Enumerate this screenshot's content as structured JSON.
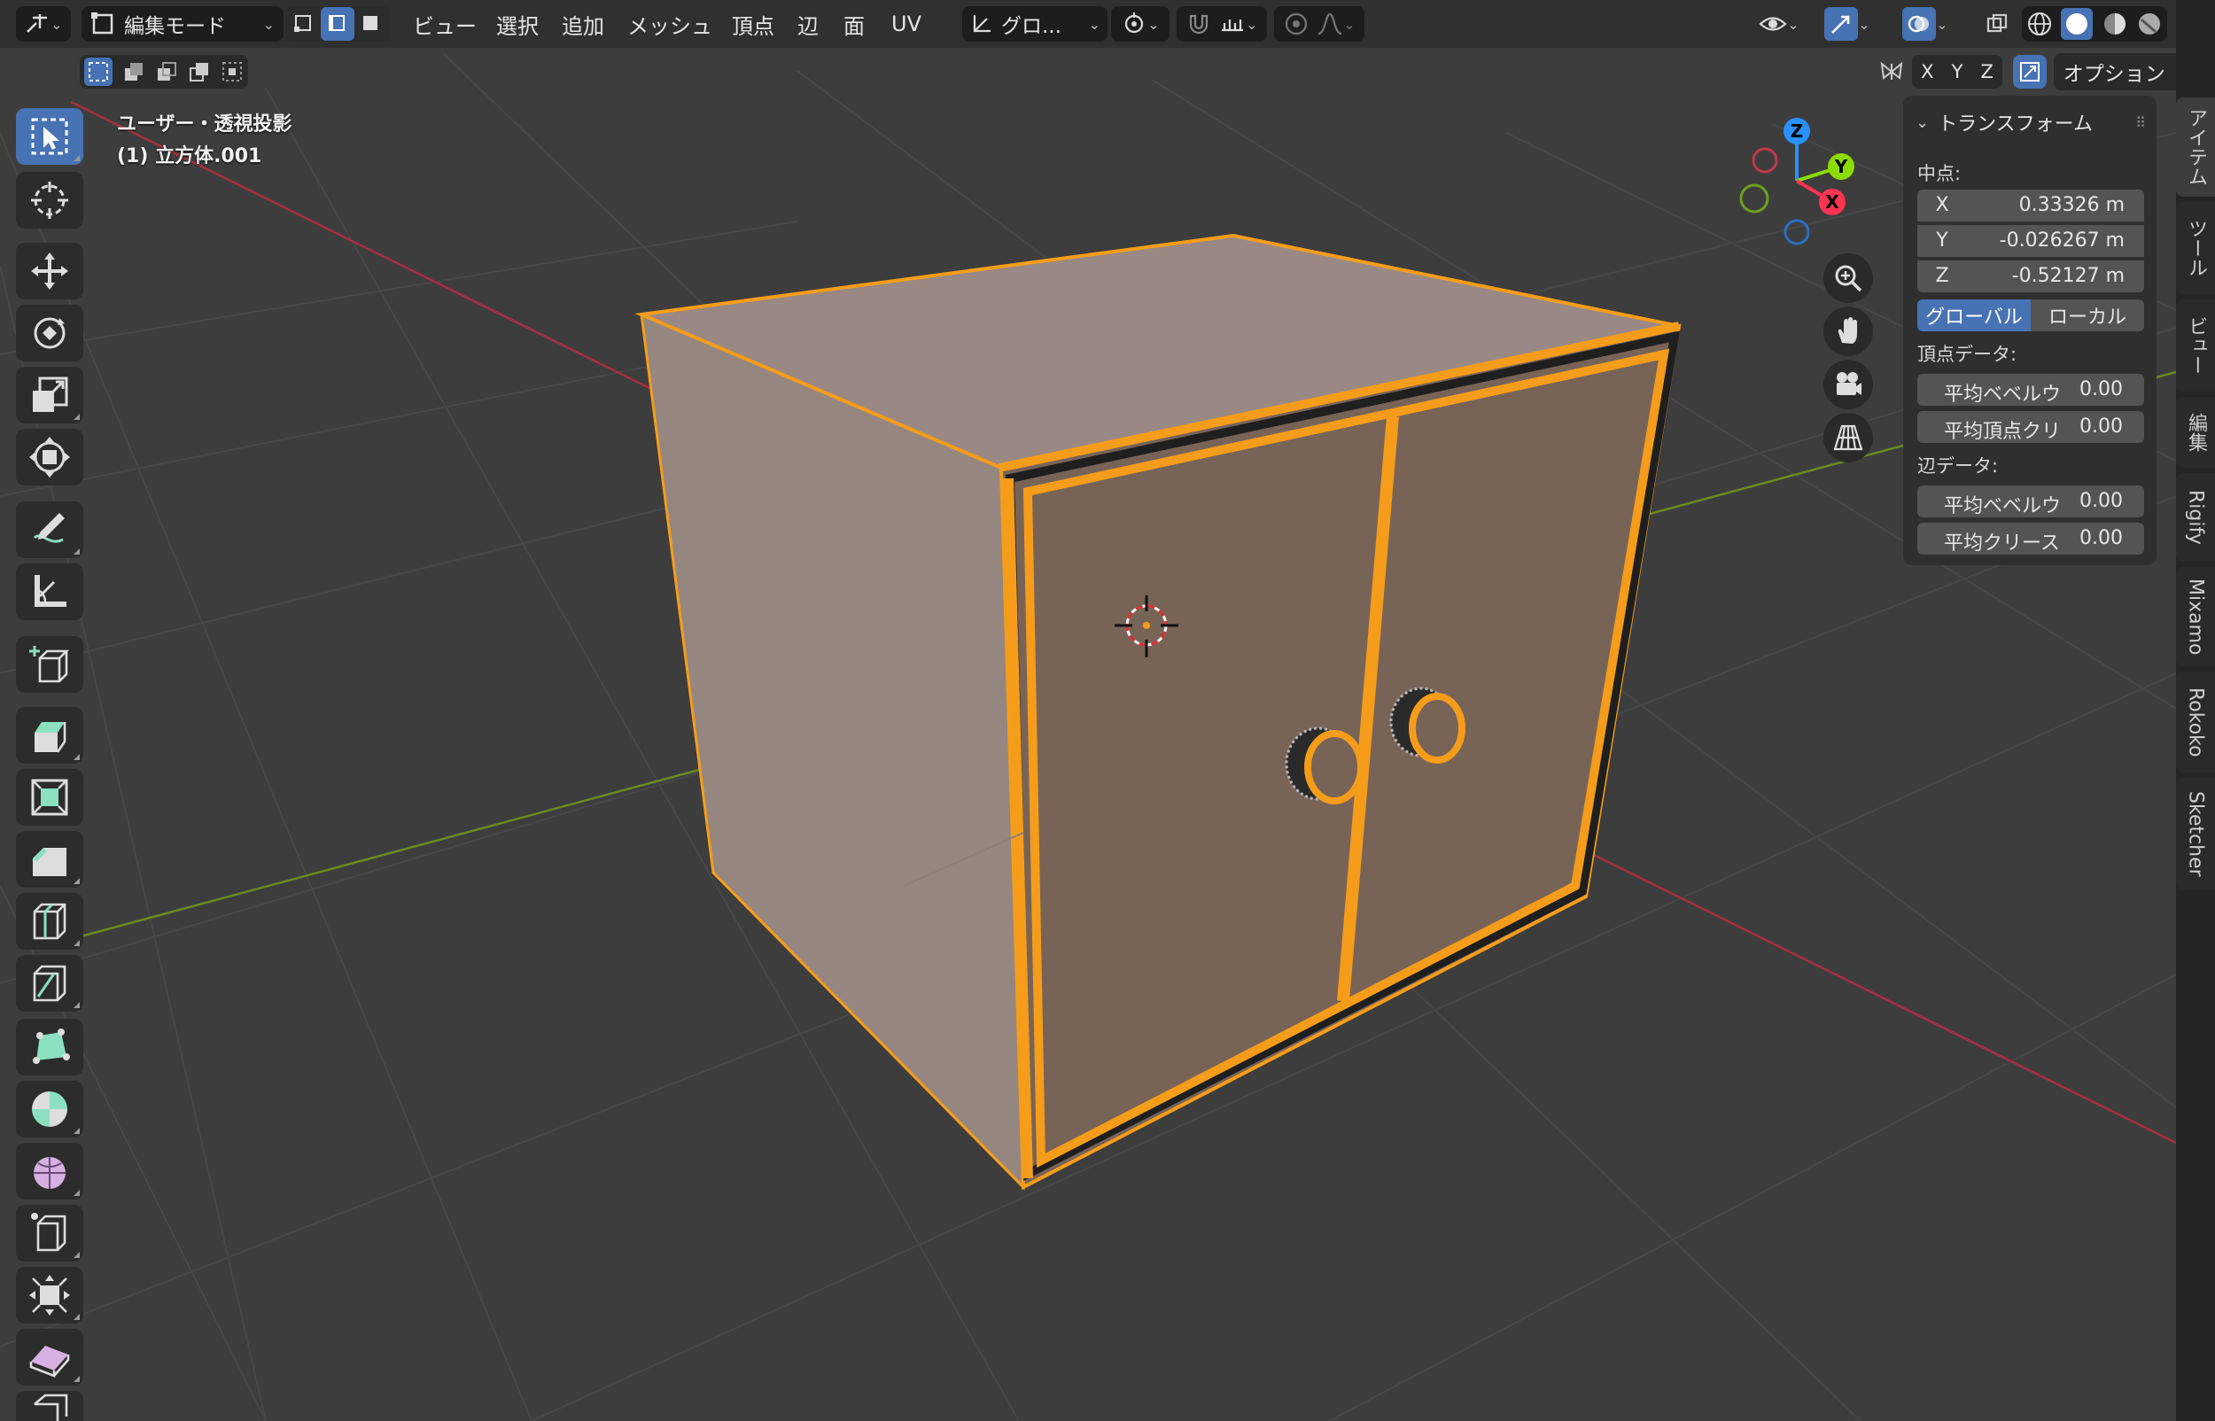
{
  "header": {
    "mode_label": "編集モード",
    "menus": [
      "ビュー",
      "選択",
      "追加",
      "メッシュ",
      "頂点",
      "辺",
      "面",
      "UV"
    ],
    "orientation_label": "グロ...",
    "axis_labels": [
      "X",
      "Y",
      "Z"
    ],
    "options_label": "オプション"
  },
  "overlay": {
    "view_name": "ユーザー・透視投影",
    "object_name": "(1) 立方体.001"
  },
  "gizmo": {
    "x": "X",
    "y": "Y",
    "z": "Z"
  },
  "npanel": {
    "title": "トランスフォーム",
    "median_label": "中点:",
    "median": [
      {
        "axis": "X",
        "value": "0.33326 m"
      },
      {
        "axis": "Y",
        "value": "-0.026267 m"
      },
      {
        "axis": "Z",
        "value": "-0.52127 m"
      }
    ],
    "space_global": "グローバル",
    "space_local": "ローカル",
    "vertex_data_label": "頂点データ:",
    "vertex_data": [
      {
        "label": "平均ベベルウ",
        "value": "0.00"
      },
      {
        "label": "平均頂点クリ",
        "value": "0.00"
      }
    ],
    "edge_data_label": "辺データ:",
    "edge_data": [
      {
        "label": "平均ベベルウ",
        "value": "0.00"
      },
      {
        "label": "平均クリース",
        "value": "0.00"
      }
    ]
  },
  "side_tabs": [
    "アイテム",
    "ツール",
    "ビュー",
    "編集",
    "Rigify",
    "Mixamo",
    "Rokoko",
    "Sketcher"
  ],
  "colors": {
    "accent": "#4772b3",
    "selection": "#f5a623",
    "axis_x": "#ff3352",
    "axis_y": "#8bdc00",
    "axis_z": "#2890ff"
  }
}
